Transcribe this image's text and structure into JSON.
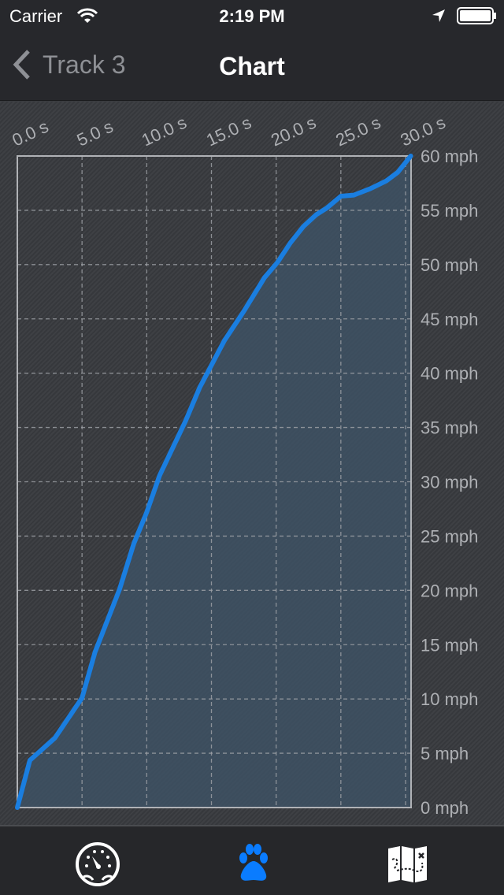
{
  "status_bar": {
    "carrier": "Carrier",
    "time": "2:19 PM",
    "icons": [
      "wifi-icon",
      "location-arrow-icon",
      "battery-icon"
    ]
  },
  "nav": {
    "back_label": "Track 3",
    "title": "Chart"
  },
  "colors": {
    "line": "#1a7ee0",
    "fill": "#3f5468",
    "grid": "#a0a3a8",
    "tab_active": "#0a7cff"
  },
  "chart_data": {
    "type": "area",
    "xlabel": "",
    "ylabel": "",
    "xlim": [
      0,
      30.4
    ],
    "ylim": [
      0,
      60
    ],
    "grid": true,
    "x_ticks": [
      0,
      5,
      10,
      15,
      20,
      25,
      30
    ],
    "x_tick_labels": [
      "0.0 s",
      "5.0 s",
      "10.0 s",
      "15.0 s",
      "20.0 s",
      "25.0 s",
      "30.0 s"
    ],
    "y_ticks": [
      0,
      5,
      10,
      15,
      20,
      25,
      30,
      35,
      40,
      45,
      50,
      55,
      60
    ],
    "y_tick_labels": [
      "0 mph",
      "5 mph",
      "10 mph",
      "15 mph",
      "20 mph",
      "25 mph",
      "30 mph",
      "35 mph",
      "40 mph",
      "45 mph",
      "50 mph",
      "55 mph",
      "60 mph"
    ],
    "series": [
      {
        "x": [
          0,
          0.97,
          2.9,
          5.0,
          6.0,
          7.9,
          9.0,
          10.0,
          11.0,
          13.0,
          14.1,
          16.0,
          17.5,
          19.1,
          20.1,
          21.1,
          22.1,
          23.1,
          23.9,
          25.0,
          26.0,
          27.3,
          28.5,
          29.4,
          30.4
        ],
        "y": [
          0,
          4.35,
          6.4,
          10.1,
          14.3,
          20.1,
          24.3,
          27.2,
          30.6,
          35.6,
          38.7,
          43.0,
          45.7,
          48.8,
          50.2,
          52.0,
          53.5,
          54.6,
          55.2,
          56.3,
          56.4,
          57.0,
          57.7,
          58.5,
          60.0
        ]
      }
    ]
  },
  "tabs": [
    {
      "icon": "speedometer-icon",
      "active": false
    },
    {
      "icon": "paw-icon",
      "active": true
    },
    {
      "icon": "treasure-map-icon",
      "active": false
    }
  ]
}
